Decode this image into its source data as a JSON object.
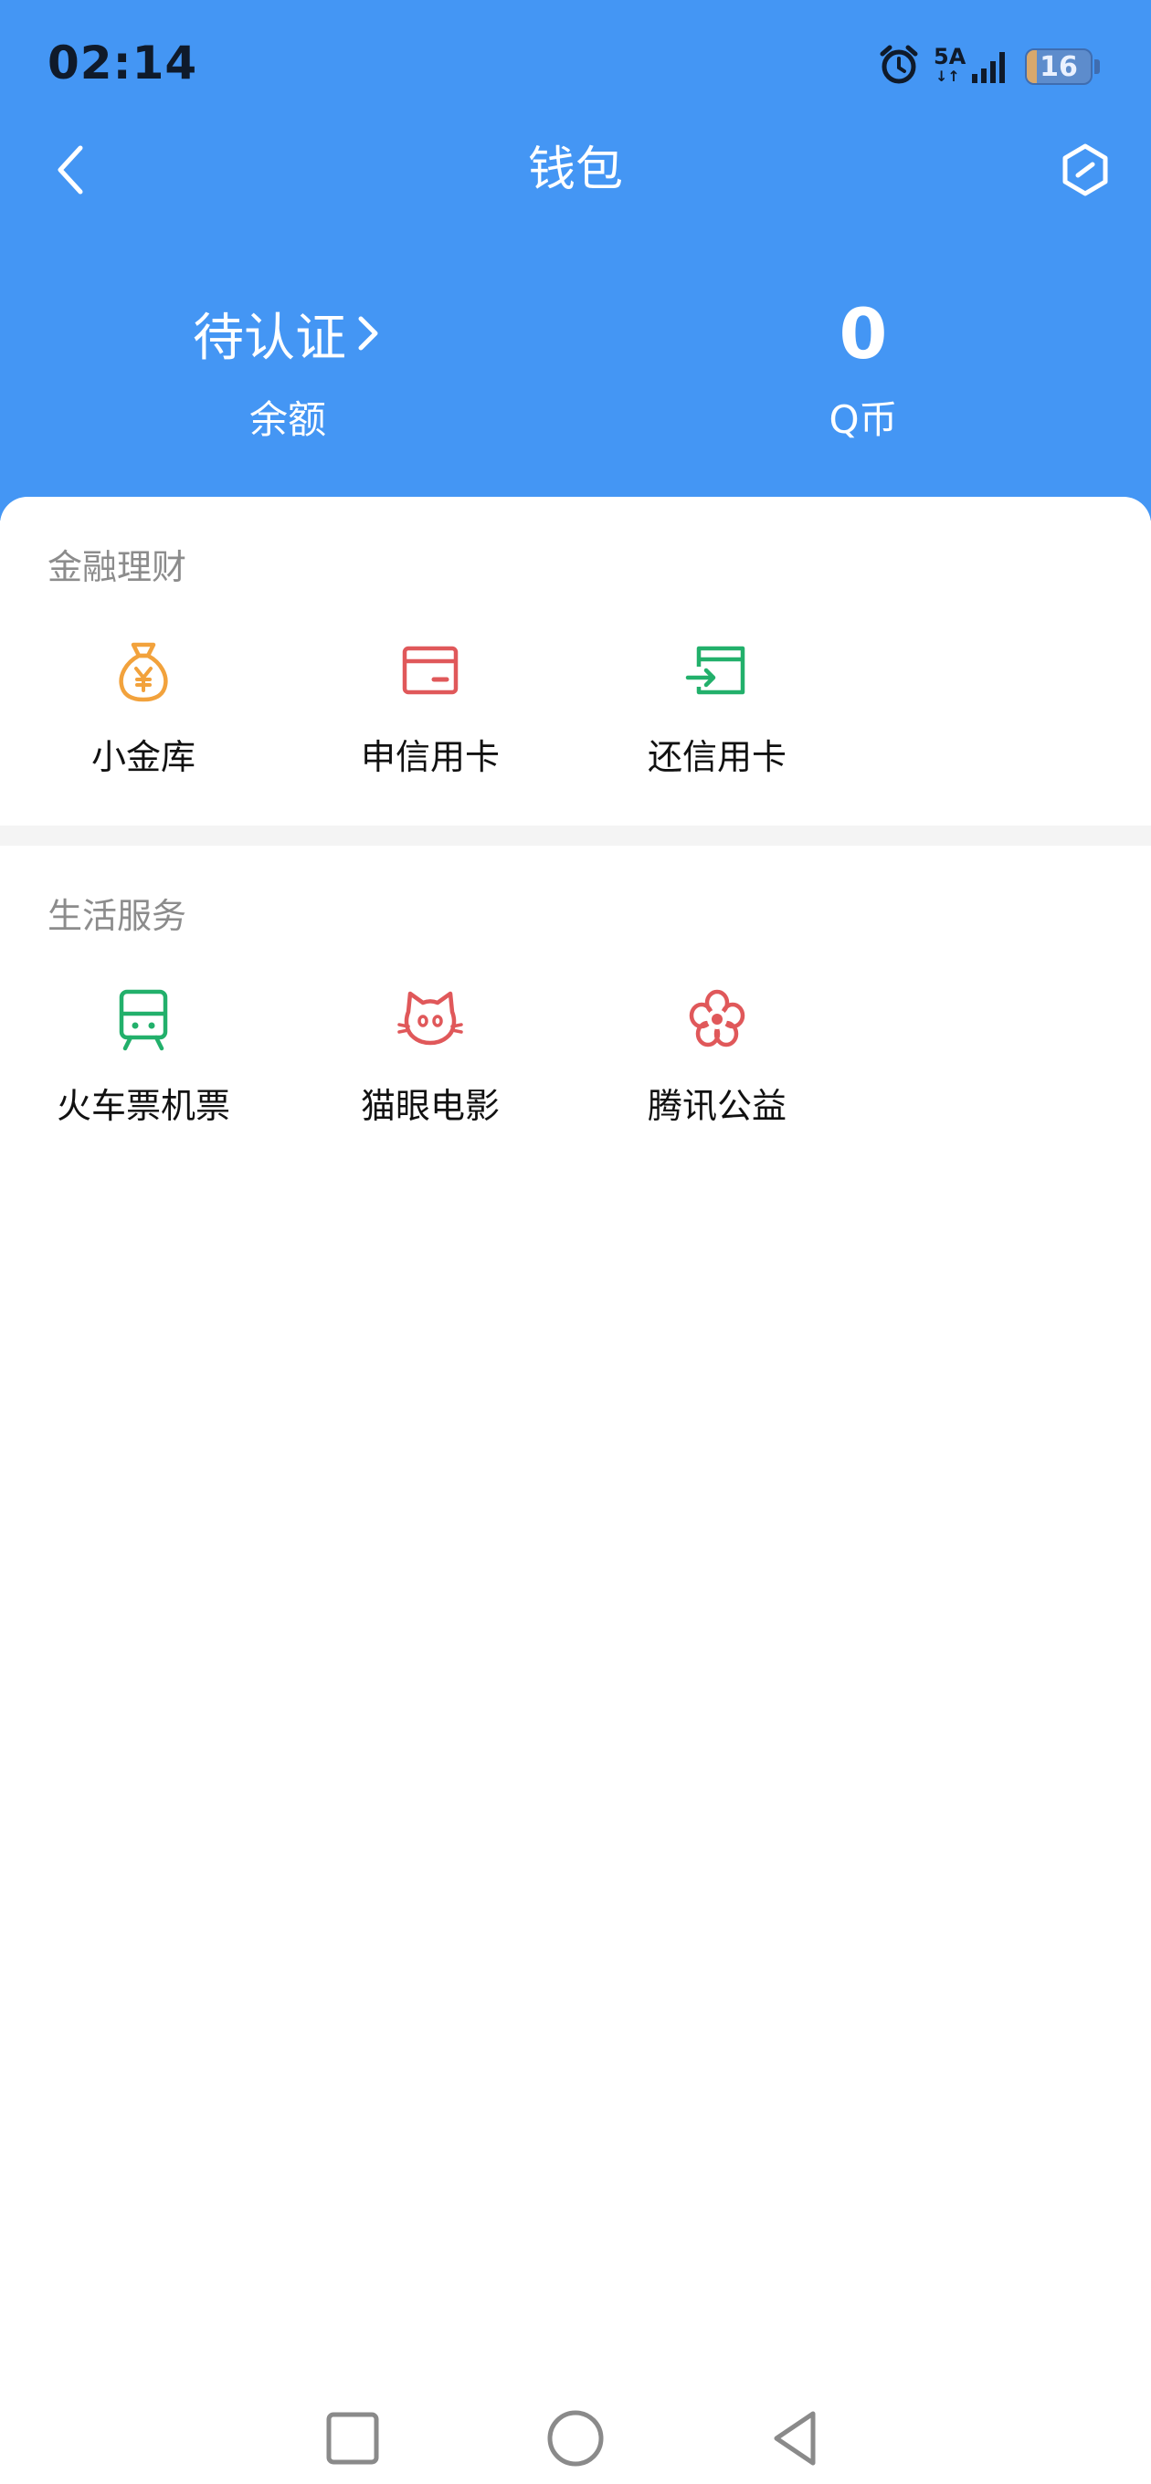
{
  "status_bar": {
    "time": "02:14",
    "network_gen": "5A",
    "network_arrows": "↓↑",
    "battery_percent": "16",
    "battery_level": 0.16,
    "icons": [
      "alarm-icon",
      "signal-icon",
      "battery-icon"
    ]
  },
  "header": {
    "title": "钱包",
    "back_icon": "chevron-left-icon",
    "settings_icon": "hexagon-settings-icon",
    "background_color": "#4496F4"
  },
  "summary": {
    "balance_value": "待认证",
    "balance_label": "余额",
    "coins_value": "0",
    "coins_label": "Q币"
  },
  "sections": [
    {
      "title": "金融理财",
      "items": [
        {
          "label": "小金库",
          "icon": "money-bag-icon",
          "color": "#F2A23C"
        },
        {
          "label": "申信用卡",
          "icon": "credit-card-icon",
          "color": "#E0585A"
        },
        {
          "label": "还信用卡",
          "icon": "card-repay-icon",
          "color": "#22B06B"
        }
      ]
    },
    {
      "title": "生活服务",
      "items": [
        {
          "label": "火车票机票",
          "icon": "train-icon",
          "color": "#22B06B"
        },
        {
          "label": "猫眼电影",
          "icon": "cat-face-icon",
          "color": "#E0585A"
        },
        {
          "label": "腾讯公益",
          "icon": "flower-icon",
          "color": "#E0585A"
        }
      ]
    }
  ],
  "nav_bar": {
    "items": [
      "recent-apps-icon",
      "home-icon",
      "back-triangle-icon"
    ]
  }
}
